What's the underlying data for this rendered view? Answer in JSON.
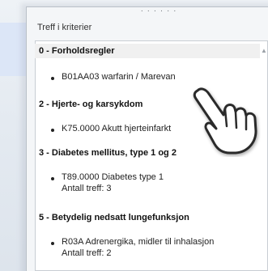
{
  "panel": {
    "title": "Treff i kriterier",
    "grip": "· · · · · ·"
  },
  "categories": [
    {
      "title": "0 - Forholdsregler",
      "selected": true,
      "items": [
        {
          "code": "B01AA03 warfarin / Marevan",
          "count": ""
        }
      ]
    },
    {
      "title": "2 - Hjerte- og karsykdom",
      "items": [
        {
          "code": "K75.0000 Akutt hjerteinfarkt",
          "count": ""
        }
      ]
    },
    {
      "title": "3 - Diabetes mellitus, type 1 og 2",
      "items": [
        {
          "code": "T89.0000 Diabetes type 1",
          "count": "Antall treff: 3"
        }
      ]
    },
    {
      "title": "5 - Betydelig nedsatt lungefunksjon",
      "items": [
        {
          "code": "R03A Adrenergika, midler til inhalasjon",
          "count": "Antall treff: 2"
        }
      ]
    }
  ],
  "icons": {
    "pointer": "hand-pointer-icon",
    "scroll": "scroll-up-arrow-icon"
  }
}
